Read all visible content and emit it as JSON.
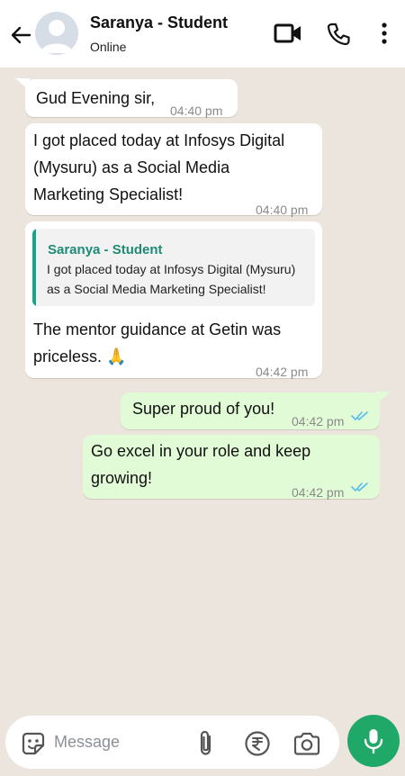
{
  "header": {
    "contact_name": "Saranya - Student",
    "status": "Online",
    "icons": [
      "back-arrow-icon",
      "avatar-placeholder",
      "video-call-icon",
      "voice-call-icon",
      "more-options-icon"
    ]
  },
  "messages": [
    {
      "direction": "incoming",
      "text": "Gud Evening sir,",
      "time": "04:40 pm"
    },
    {
      "direction": "incoming",
      "lines": [
        "I got placed today at Infosys Digital",
        "(Mysuru) as a Social Media",
        "Marketing Specialist!"
      ],
      "time": "04:40 pm"
    },
    {
      "direction": "incoming",
      "quote": {
        "author": "Saranya - Student",
        "lines": [
          "I got placed today at Infosys Digital (Mysuru)",
          "as a Social Media Marketing Specialist!"
        ]
      },
      "lines": [
        "The mentor guidance at Getin was",
        "priceless. 🙏"
      ],
      "time": "04:42 pm"
    },
    {
      "direction": "outgoing",
      "text": "Super proud of you!",
      "time": "04:42 pm",
      "status": "read"
    },
    {
      "direction": "outgoing",
      "lines": [
        "Go excel in your role and keep",
        "growing!"
      ],
      "time": "04:42 pm",
      "status": "read"
    }
  ],
  "composer": {
    "placeholder": "Message",
    "icons": [
      "sticker-icon",
      "attach-icon",
      "rupee-payment-icon",
      "camera-icon",
      "mic-icon"
    ]
  },
  "colors": {
    "chat_background": "#ece5dd",
    "outgoing_bubble": "#e2fbd7",
    "incoming_bubble": "#ffffff",
    "accent_green": "#20a868",
    "quote_author": "#1f8a76",
    "read_ticks": "#53bdeb"
  }
}
